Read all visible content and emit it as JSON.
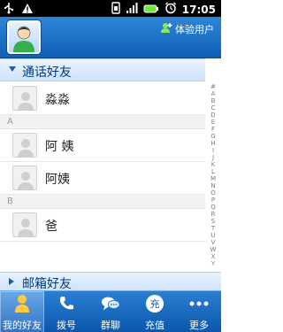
{
  "status_bar": {
    "time": "17:05",
    "icons": [
      "usb-icon",
      "warning-icon",
      "signal-icon",
      "battery-icon",
      "alarm-icon"
    ]
  },
  "header": {
    "experience_user": "体验用户"
  },
  "groups": {
    "call_friends": "通话好友",
    "mailbox_friends": "邮箱好友"
  },
  "contacts": [
    {
      "name": "淼淼"
    },
    {
      "name": "阿 姨"
    },
    {
      "name": "阿姨"
    },
    {
      "name": "爸"
    }
  ],
  "letters": [
    "A",
    "B"
  ],
  "index_letters": [
    "#",
    "A",
    "B",
    "C",
    "D",
    "E",
    "F",
    "G",
    "H",
    "I",
    "J",
    "K",
    "L",
    "M",
    "N",
    "O",
    "P",
    "Q",
    "R",
    "S",
    "T",
    "U",
    "V",
    "W",
    "X",
    "Y",
    "Z"
  ],
  "tabs": [
    {
      "label": "我的好友",
      "icon": "person-icon",
      "active": true
    },
    {
      "label": "拨号",
      "icon": "phone-icon"
    },
    {
      "label": "群聊",
      "icon": "chat-bubbles-icon"
    },
    {
      "label": "充值",
      "icon": "recharge-icon"
    },
    {
      "label": "更多",
      "icon": "more-dots-icon"
    }
  ],
  "colors": {
    "header_blue": "#1a6fc8",
    "group_text": "#003b7c",
    "tabbar_blue": "#0b57ac"
  }
}
